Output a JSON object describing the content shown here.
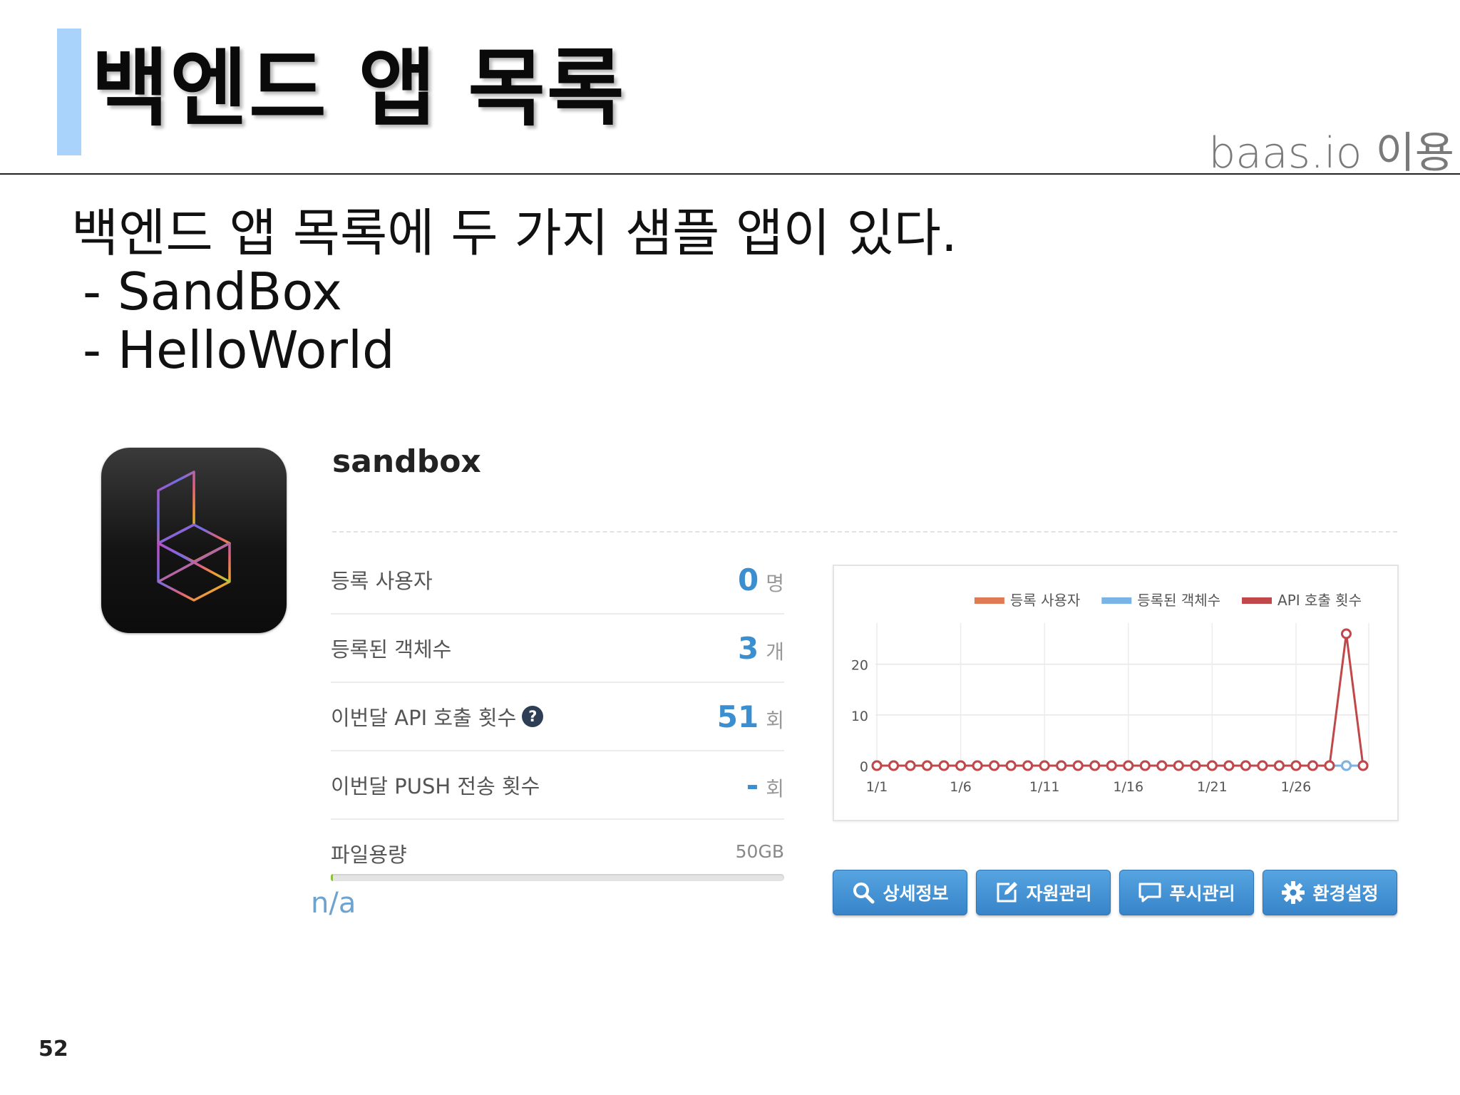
{
  "slide": {
    "title": "백엔드 앱 목록",
    "subtitle": "baas.io 이용",
    "intro": "백엔드 앱 목록에 두 가지 샘플 앱이 있다.",
    "bullets": [
      "- SandBox",
      "- HelloWorld"
    ],
    "page_number": "52"
  },
  "app": {
    "name": "sandbox",
    "stats": [
      {
        "label": "등록 사용자",
        "value": "0",
        "unit": "명"
      },
      {
        "label": "등록된 객체수",
        "value": "3",
        "unit": "개"
      },
      {
        "label": "이번달 API 호출 횟수",
        "value": "51",
        "unit": "회",
        "help": "?"
      },
      {
        "label": "이번달 PUSH 전송 횟수",
        "value": "-",
        "unit": "회"
      }
    ],
    "file_storage": {
      "label": "파일용량",
      "capacity": "50GB",
      "usage_fraction": 0.004,
      "usage_text": "n/a"
    },
    "buttons": [
      {
        "label": "상세정보",
        "icon": "search-icon"
      },
      {
        "label": "자원관리",
        "icon": "edit-icon"
      },
      {
        "label": "푸시관리",
        "icon": "chat-icon"
      },
      {
        "label": "환경설정",
        "icon": "gear-icon"
      }
    ]
  },
  "chart_data": {
    "type": "line",
    "x": [
      "1/1",
      "1/2",
      "1/3",
      "1/4",
      "1/5",
      "1/6",
      "1/7",
      "1/8",
      "1/9",
      "1/10",
      "1/11",
      "1/12",
      "1/13",
      "1/14",
      "1/15",
      "1/16",
      "1/17",
      "1/18",
      "1/19",
      "1/20",
      "1/21",
      "1/22",
      "1/23",
      "1/24",
      "1/25",
      "1/26",
      "1/27",
      "1/28",
      "1/29",
      "1/30"
    ],
    "x_tick_labels": [
      "1/1",
      "1/6",
      "1/11",
      "1/16",
      "1/21",
      "1/26"
    ],
    "y_tick_labels": [
      "0",
      "10",
      "20"
    ],
    "ylim": [
      0,
      26
    ],
    "series": [
      {
        "name": "등록 사용자",
        "color": "#e07a55",
        "values": [
          0,
          0,
          0,
          0,
          0,
          0,
          0,
          0,
          0,
          0,
          0,
          0,
          0,
          0,
          0,
          0,
          0,
          0,
          0,
          0,
          0,
          0,
          0,
          0,
          0,
          0,
          0,
          0,
          0,
          0
        ]
      },
      {
        "name": "등록된 객체수",
        "color": "#7ab3e6",
        "values": [
          0,
          0,
          0,
          0,
          0,
          0,
          0,
          0,
          0,
          0,
          0,
          0,
          0,
          0,
          0,
          0,
          0,
          0,
          0,
          0,
          0,
          0,
          0,
          0,
          0,
          0,
          0,
          0,
          0,
          0
        ]
      },
      {
        "name": "API 호출 횟수",
        "color": "#c0474a",
        "values": [
          0,
          0,
          0,
          0,
          0,
          0,
          0,
          0,
          0,
          0,
          0,
          0,
          0,
          0,
          0,
          0,
          0,
          0,
          0,
          0,
          0,
          0,
          0,
          0,
          0,
          0,
          0,
          0,
          26,
          0
        ]
      }
    ],
    "grid": true,
    "legend": "top-right"
  }
}
